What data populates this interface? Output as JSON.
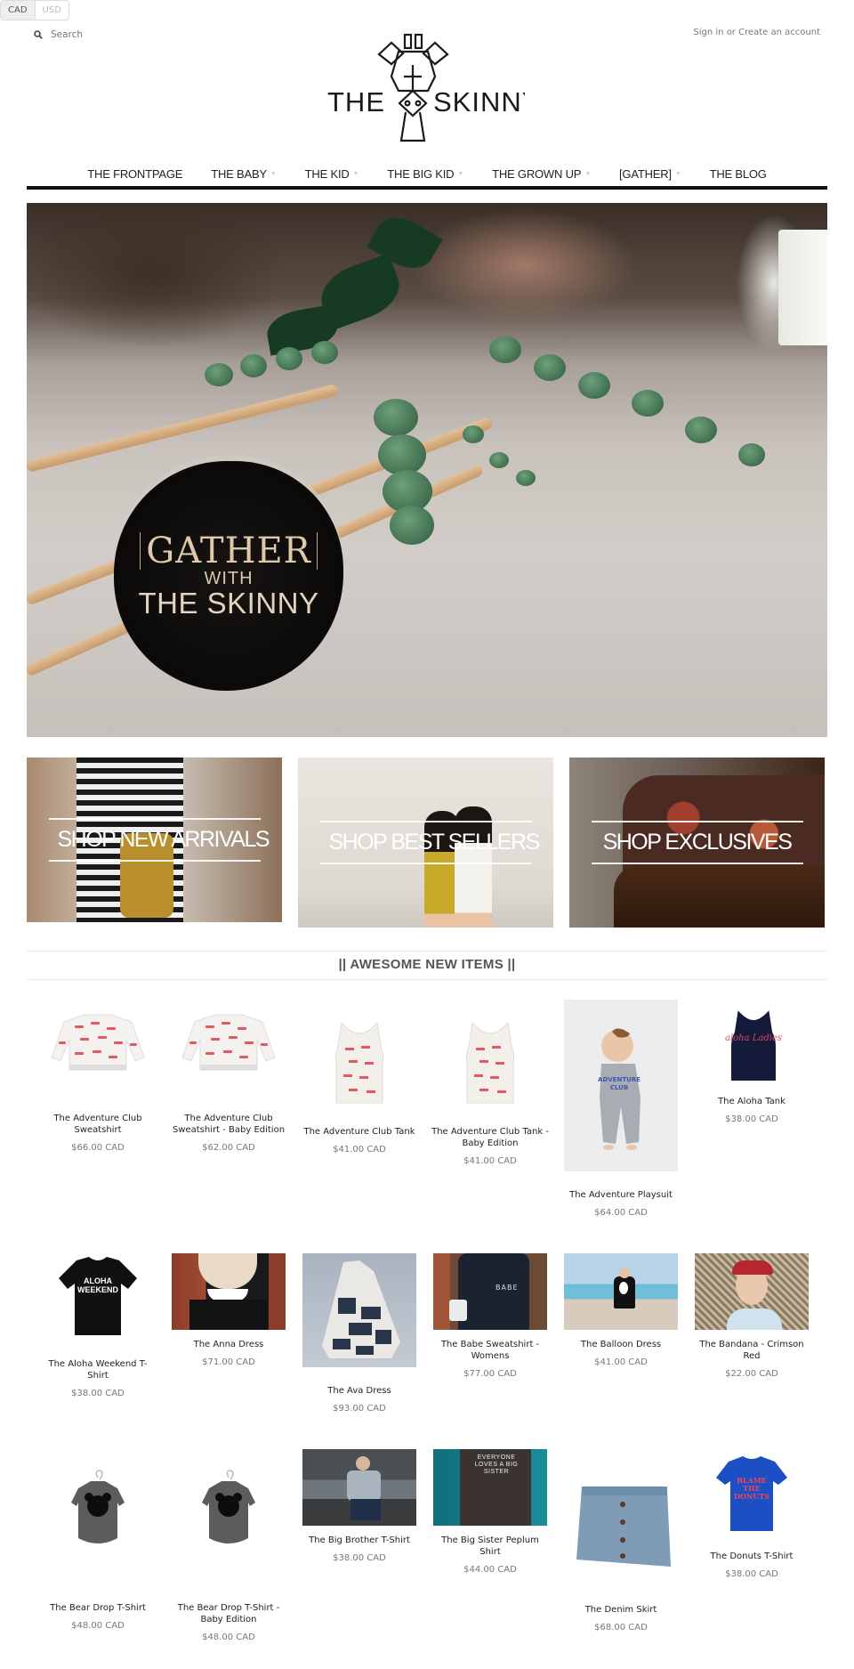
{
  "currency": {
    "options": [
      "CAD",
      "USD"
    ],
    "selected": "CAD"
  },
  "search": {
    "placeholder": "Search",
    "icon": "search-icon"
  },
  "account": {
    "sign_in": "Sign in",
    "separator": "or",
    "create": "Create an account"
  },
  "logo": {
    "left_text": "THE",
    "right_text": "SKINNY",
    "alt": "The Skinny giraffe logo"
  },
  "nav": {
    "items": [
      {
        "label": "THE FRONTPAGE",
        "has_dropdown": false
      },
      {
        "label": "THE BABY",
        "has_dropdown": true
      },
      {
        "label": "THE KID",
        "has_dropdown": true
      },
      {
        "label": "THE BIG KID",
        "has_dropdown": true
      },
      {
        "label": "THE GROWN UP",
        "has_dropdown": true
      },
      {
        "label": "[GATHER]",
        "has_dropdown": true
      },
      {
        "label": "THE BLOG",
        "has_dropdown": false
      }
    ],
    "caret": "▼"
  },
  "hero": {
    "badge_line1": "[GATHER]",
    "badge_line1_text": "GATHER",
    "badge_line2": "WITH",
    "badge_line3": "THE SKINNY"
  },
  "promos": [
    {
      "label": "SHOP NEW ARRIVALS"
    },
    {
      "label": "SHOP BEST SELLERS"
    },
    {
      "label": "SHOP EXCLUSIVES"
    }
  ],
  "section": {
    "title": "|| AWESOME NEW ITEMS ||"
  },
  "products": [
    {
      "name": "The Adventure Club Sweatshirt",
      "price": "$66.00 CAD"
    },
    {
      "name": "The Adventure Club Sweatshirt - Baby Edition",
      "price": "$62.00 CAD"
    },
    {
      "name": "The Adventure Club Tank",
      "price": "$41.00 CAD"
    },
    {
      "name": "The Adventure Club Tank - Baby Edition",
      "price": "$41.00 CAD"
    },
    {
      "name": "The Adventure Playsuit",
      "price": "$64.00 CAD"
    },
    {
      "name": "The Aloha Tank",
      "price": "$38.00 CAD"
    },
    {
      "name": "The Aloha Weekend T-Shirt",
      "price": "$38.00 CAD"
    },
    {
      "name": "The Anna Dress",
      "price": "$71.00 CAD"
    },
    {
      "name": "The Ava Dress",
      "price": "$93.00 CAD"
    },
    {
      "name": "The Babe Sweatshirt - Womens",
      "price": "$77.00 CAD"
    },
    {
      "name": "The Balloon Dress",
      "price": "$41.00 CAD"
    },
    {
      "name": "The Bandana - Crimson Red",
      "price": "$22.00 CAD"
    },
    {
      "name": "The Bear Drop T-Shirt",
      "price": "$48.00 CAD"
    },
    {
      "name": "The Bear Drop T-Shirt - Baby Edition",
      "price": "$48.00 CAD"
    },
    {
      "name": "The Big Brother T-Shirt",
      "price": "$38.00 CAD"
    },
    {
      "name": "The Big Sister Peplum Shirt",
      "price": "$44.00 CAD"
    },
    {
      "name": "The Denim Skirt",
      "price": "$68.00 CAD"
    },
    {
      "name": "The Donuts T-Shirt",
      "price": "$38.00 CAD"
    }
  ],
  "product_image_text": {
    "aloha_tank": "aloha Ladies",
    "aloha_weekend": "ALOHA WEEKEND",
    "babe": "BABE",
    "big_sister": "EVERYONE LOVES A BIG SISTER",
    "donuts": "BLAME THE DONUTS"
  }
}
